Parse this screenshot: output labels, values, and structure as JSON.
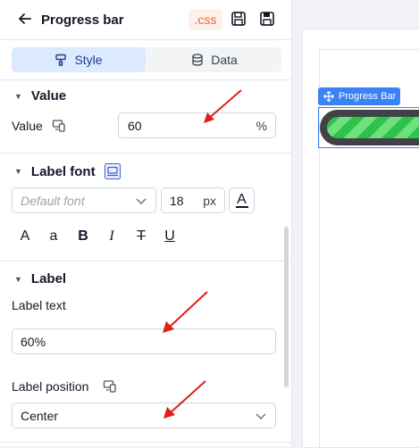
{
  "header": {
    "title": "Progress bar",
    "css_badge": ".css"
  },
  "tabs": [
    {
      "label": "Style",
      "active": true
    },
    {
      "label": "Data",
      "active": false
    }
  ],
  "value_section": {
    "title": "Value",
    "field_label": "Value",
    "value": "60",
    "unit": "%"
  },
  "label_font_section": {
    "title": "Label font",
    "font_placeholder": "Default font",
    "size": "18",
    "size_unit": "px",
    "color_glyph": "A",
    "format_buttons": [
      "A",
      "a",
      "B",
      "I",
      "T",
      "U"
    ]
  },
  "label_section": {
    "title": "Label",
    "text_label": "Label text",
    "text_value": "60%",
    "position_label": "Label position",
    "position_value": "Center"
  },
  "canvas": {
    "widget_tag": "Progress Bar",
    "progress_fraction": 0.6
  },
  "colors": {
    "accent": "#3b82f6",
    "arrow": "#e11d1d",
    "bar_green": "#2ec24a",
    "track": "#3f4346",
    "css_badge": "#e36a3b"
  }
}
